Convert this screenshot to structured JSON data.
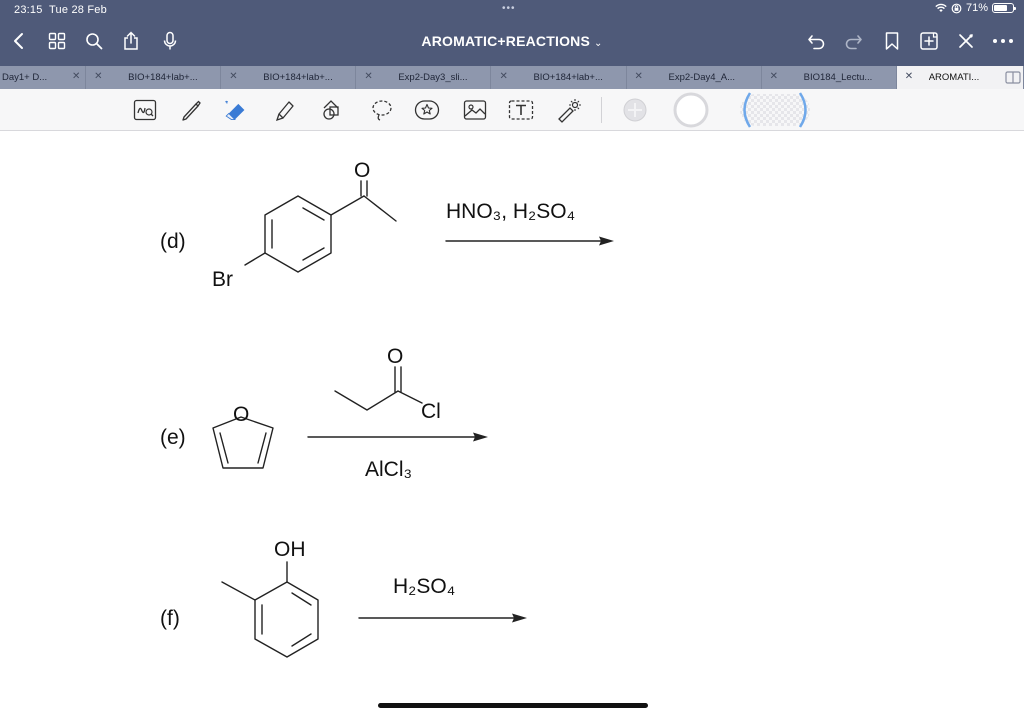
{
  "status": {
    "time": "23:15",
    "date": "Tue 28 Feb",
    "battery": "71%",
    "battery_level": 0.71
  },
  "header": {
    "title": "AROMATIC+REACTIONS"
  },
  "tabs": [
    {
      "label": "Day1+ D...",
      "active": false
    },
    {
      "label": "BIO+184+lab+...",
      "active": false
    },
    {
      "label": "BIO+184+lab+...",
      "active": false
    },
    {
      "label": "Exp2-Day3_sli...",
      "active": false
    },
    {
      "label": "BIO+184+lab+...",
      "active": false
    },
    {
      "label": "Exp2-Day4_A...",
      "active": false
    },
    {
      "label": "BIO184_Lectu...",
      "active": false
    },
    {
      "label": "AROMATI...",
      "active": true
    }
  ],
  "toolbar": {
    "tools": [
      "lasso-text-icon",
      "pen-icon",
      "eraser-icon",
      "highlighter-icon",
      "shapes-icon",
      "lasso-icon",
      "sticker-icon",
      "image-icon",
      "text-box-icon",
      "laser-pointer-icon"
    ],
    "colors": {
      "accent": "#4f5a79",
      "eraser": "#3a7bd5",
      "selection": "#6fa8ea"
    }
  },
  "reactions": {
    "d": {
      "label": "(d)",
      "reagent_above": "HNO₃, H₂SO₄",
      "reagent_below": "",
      "substituent": "Br",
      "carbonyl_o": "O"
    },
    "e": {
      "label": "(e)",
      "reagent_above_cl": "Cl",
      "reagent_above_o": "O",
      "reagent_below": "AlCl₃",
      "ring_o": "O"
    },
    "f": {
      "label": "(f)",
      "reagent_above": "H₂SO₄",
      "substituent": "OH"
    }
  }
}
